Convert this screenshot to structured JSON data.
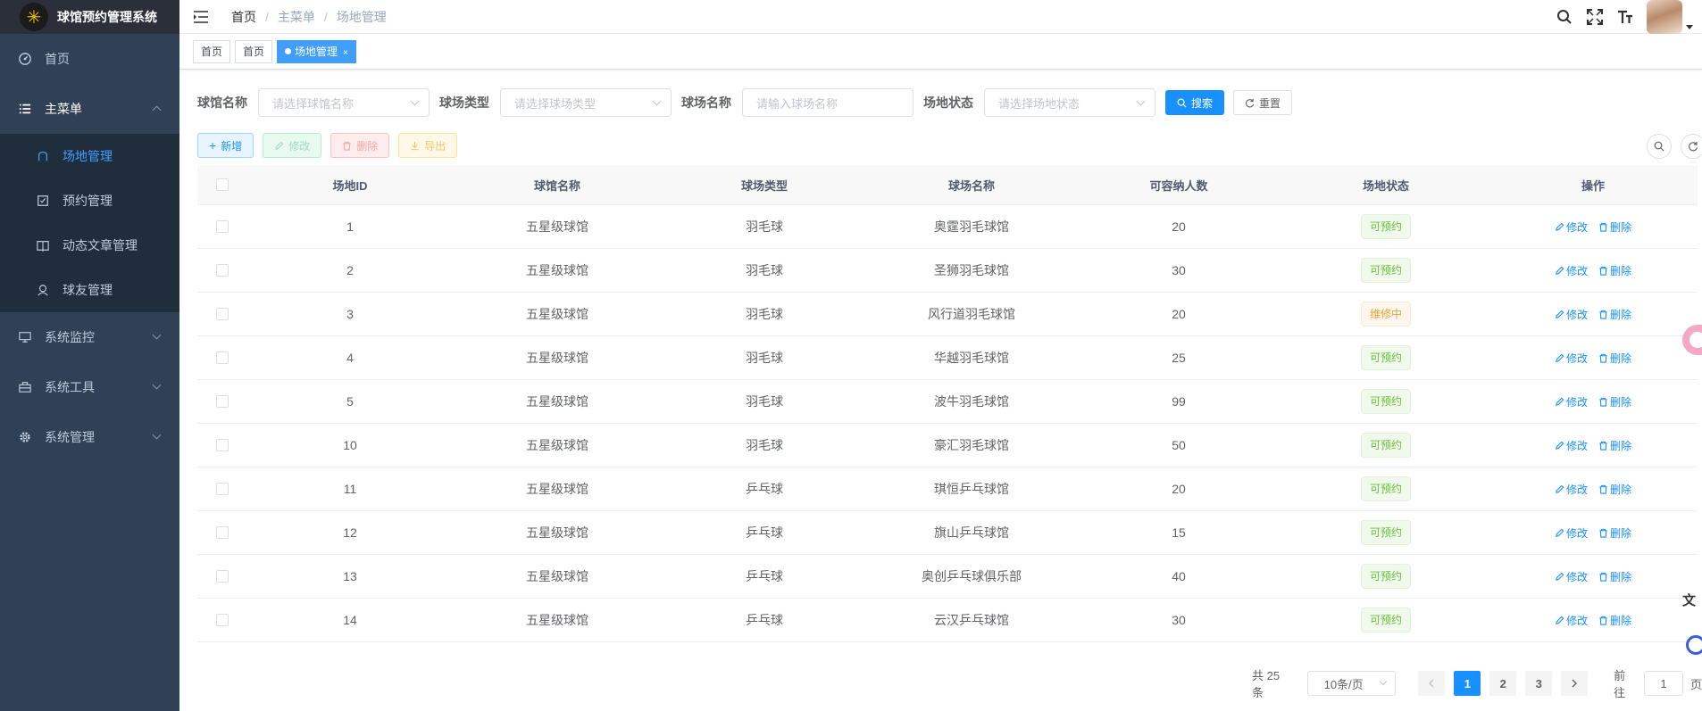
{
  "app": {
    "title": "球馆预约管理系统"
  },
  "sidebar": {
    "home": "首页",
    "main_menu": "主菜单",
    "sub_items": [
      {
        "label": "场地管理",
        "active": true,
        "icon": "venue-icon"
      },
      {
        "label": "预约管理",
        "active": false,
        "icon": "checkbox-icon"
      },
      {
        "label": "动态文章管理",
        "active": false,
        "icon": "book-icon"
      },
      {
        "label": "球友管理",
        "active": false,
        "icon": "user-group-icon"
      }
    ],
    "monitor": "系统监控",
    "tools": "系统工具",
    "admin": "系统管理"
  },
  "breadcrumb": {
    "home": "首页",
    "menu": "主菜单",
    "current": "场地管理"
  },
  "tags": {
    "t1": "首页",
    "t2": "首页",
    "active": "场地管理",
    "close": "×"
  },
  "search": {
    "venue_label": "球馆名称",
    "venue_placeholder": "请选择球馆名称",
    "type_label": "球场类型",
    "type_placeholder": "请选择球场类型",
    "court_label": "球场名称",
    "court_placeholder": "请输入球场名称",
    "status_label": "场地状态",
    "status_placeholder": "请选择场地状态",
    "search_btn": "搜索",
    "reset_btn": "重置"
  },
  "toolbar": {
    "add": "新增",
    "edit": "修改",
    "delete": "删除",
    "export": "导出"
  },
  "table": {
    "headers": [
      "场地ID",
      "球馆名称",
      "球场类型",
      "球场名称",
      "可容纳人数",
      "场地状态",
      "操作"
    ],
    "edit_label": "修改",
    "delete_label": "删除",
    "rows": [
      {
        "id": "1",
        "venue": "五星级球馆",
        "type": "羽毛球",
        "name": "奥霆羽毛球馆",
        "cap": "20",
        "status": "可预约",
        "ok": true
      },
      {
        "id": "2",
        "venue": "五星级球馆",
        "type": "羽毛球",
        "name": "圣狮羽毛球馆",
        "cap": "30",
        "status": "可预约",
        "ok": true
      },
      {
        "id": "3",
        "venue": "五星级球馆",
        "type": "羽毛球",
        "name": "风行道羽毛球馆",
        "cap": "20",
        "status": "维修中",
        "ok": false
      },
      {
        "id": "4",
        "venue": "五星级球馆",
        "type": "羽毛球",
        "name": "华越羽毛球馆",
        "cap": "25",
        "status": "可预约",
        "ok": true
      },
      {
        "id": "5",
        "venue": "五星级球馆",
        "type": "羽毛球",
        "name": "波牛羽毛球馆",
        "cap": "99",
        "status": "可预约",
        "ok": true
      },
      {
        "id": "10",
        "venue": "五星级球馆",
        "type": "羽毛球",
        "name": "豪汇羽毛球馆",
        "cap": "50",
        "status": "可预约",
        "ok": true
      },
      {
        "id": "11",
        "venue": "五星级球馆",
        "type": "乒乓球",
        "name": "琪恒乒乓球馆",
        "cap": "20",
        "status": "可预约",
        "ok": true
      },
      {
        "id": "12",
        "venue": "五星级球馆",
        "type": "乒乓球",
        "name": "旗山乒乓球馆",
        "cap": "15",
        "status": "可预约",
        "ok": true
      },
      {
        "id": "13",
        "venue": "五星级球馆",
        "type": "乒乓球",
        "name": "奥创乒乓球俱乐部",
        "cap": "40",
        "status": "可预约",
        "ok": true
      },
      {
        "id": "14",
        "venue": "五星级球馆",
        "type": "乒乓球",
        "name": "云汉乒乓球馆",
        "cap": "30",
        "status": "可预约",
        "ok": true
      }
    ]
  },
  "pagination": {
    "total": "共 25 条",
    "page_size": "10条/页",
    "pages": [
      "1",
      "2",
      "3"
    ],
    "current": "1",
    "goto_label": "前往",
    "goto_value": "1",
    "page_unit": "页"
  },
  "colors": {
    "primary": "#1890ff",
    "sidebar_bg": "#304156",
    "active_menu": "#409eff"
  }
}
